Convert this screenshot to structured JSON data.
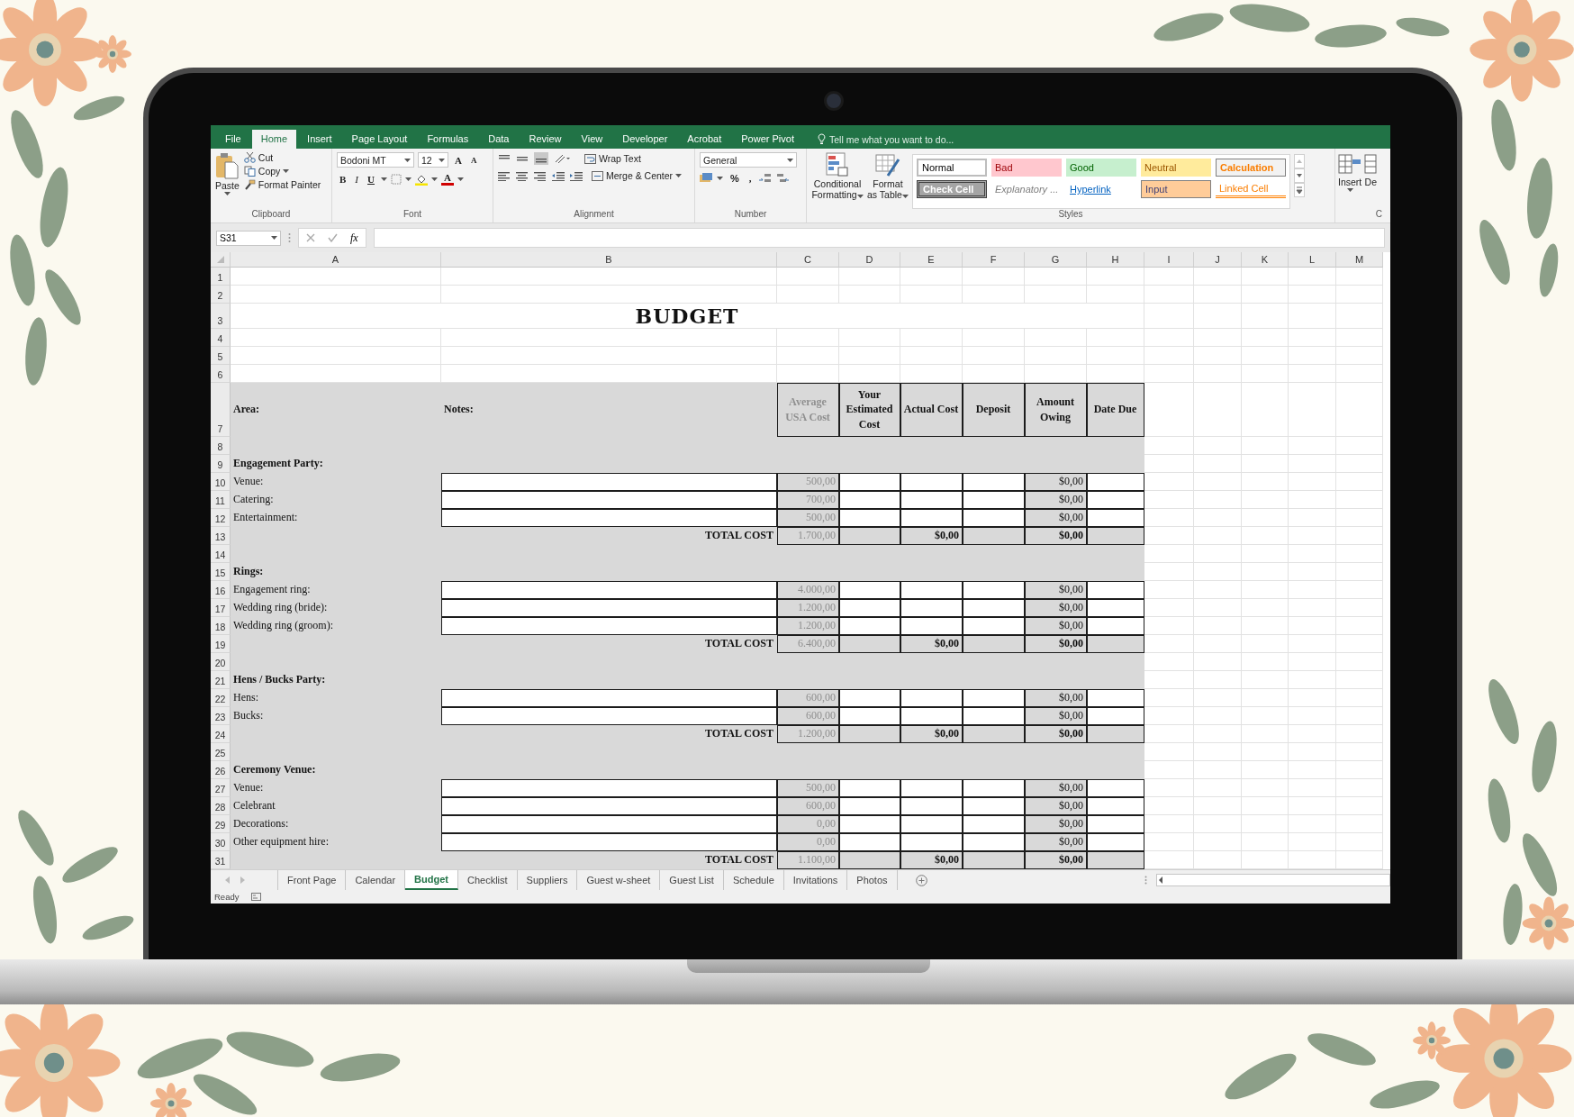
{
  "menu_tabs": [
    {
      "label": "File",
      "selected": false
    },
    {
      "label": "Home",
      "selected": true
    },
    {
      "label": "Insert",
      "selected": false
    },
    {
      "label": "Page Layout",
      "selected": false
    },
    {
      "label": "Formulas",
      "selected": false
    },
    {
      "label": "Data",
      "selected": false
    },
    {
      "label": "Review",
      "selected": false
    },
    {
      "label": "View",
      "selected": false
    },
    {
      "label": "Developer",
      "selected": false
    },
    {
      "label": "Acrobat",
      "selected": false
    },
    {
      "label": "Power Pivot",
      "selected": false
    }
  ],
  "tell_me": "Tell me what you want to do...",
  "ribbon": {
    "clipboard": {
      "label": "Clipboard",
      "paste": "Paste",
      "cut": "Cut",
      "copy": "Copy",
      "format_painter": "Format Painter"
    },
    "font": {
      "label": "Font",
      "family": "Bodoni MT",
      "size": "12",
      "grow": "A",
      "shrink": "A",
      "bold": "B",
      "italic": "I",
      "underline": "U",
      "font_color_glyph": "A"
    },
    "alignment": {
      "label": "Alignment",
      "wrap_text": "Wrap Text",
      "merge": "Merge & Center"
    },
    "number": {
      "label": "Number",
      "format": "General",
      "percent": "%",
      "comma": ","
    },
    "styles": {
      "label": "Styles",
      "conditional": "Conditional Formatting",
      "format_table": "Format as Table",
      "cell_styles": [
        {
          "label": "Normal",
          "kind": "normal"
        },
        {
          "label": "Bad",
          "kind": "bad"
        },
        {
          "label": "Good",
          "kind": "good"
        },
        {
          "label": "Neutral",
          "kind": "neutral"
        },
        {
          "label": "Calculation",
          "kind": "calculation"
        },
        {
          "label": "Check Cell",
          "kind": "check"
        },
        {
          "label": "Explanatory ...",
          "kind": "explanatory"
        },
        {
          "label": "Hyperlink",
          "kind": "hyperlink"
        },
        {
          "label": "Input",
          "kind": "input"
        },
        {
          "label": "Linked Cell",
          "kind": "linked"
        }
      ]
    },
    "cells": {
      "label": "C",
      "insert": "Insert",
      "delete": "De"
    }
  },
  "formula_bar": {
    "name_box": "S31",
    "function_label": "fx"
  },
  "sheet": {
    "columns": [
      "A",
      "B",
      "C",
      "D",
      "E",
      "F",
      "G",
      "H",
      "I",
      "J",
      "K",
      "L",
      "M"
    ],
    "rows": [
      {
        "number": "1",
        "kind": "blank"
      },
      {
        "number": "2",
        "kind": "blank"
      },
      {
        "number": "3",
        "kind": "title",
        "text": "BUDGET"
      },
      {
        "number": "4",
        "kind": "blank"
      },
      {
        "number": "5",
        "kind": "blank"
      },
      {
        "number": "6",
        "kind": "blank"
      },
      {
        "number": "7",
        "kind": "header",
        "area": "Area:",
        "notes": "Notes:",
        "columns": [
          {
            "text": "Average USA Cost",
            "muted": true
          },
          {
            "text": "Your Estimated Cost",
            "muted": false
          },
          {
            "text": "Actual Cost",
            "muted": false
          },
          {
            "text": "Deposit",
            "muted": false
          },
          {
            "text": "Amount Owing",
            "muted": false
          },
          {
            "text": "Date Due",
            "muted": false
          }
        ]
      },
      {
        "number": "8",
        "kind": "gap"
      },
      {
        "number": "9",
        "kind": "section",
        "label": "Engagement Party:"
      },
      {
        "number": "10",
        "kind": "item",
        "label": "Venue:",
        "average": "500,00",
        "owing": "$0,00"
      },
      {
        "number": "11",
        "kind": "item",
        "label": "Catering:",
        "average": "700,00",
        "owing": "$0,00"
      },
      {
        "number": "12",
        "kind": "item",
        "label": "Entertainment:",
        "average": "500,00",
        "owing": "$0,00"
      },
      {
        "number": "13",
        "kind": "total",
        "label": "TOTAL COST",
        "average": "1.700,00",
        "actual": "$0,00",
        "owing": "$0,00"
      },
      {
        "number": "14",
        "kind": "gap"
      },
      {
        "number": "15",
        "kind": "section",
        "label": "Rings:"
      },
      {
        "number": "16",
        "kind": "item",
        "label": "Engagement ring:",
        "average": "4.000,00",
        "owing": "$0,00"
      },
      {
        "number": "17",
        "kind": "item",
        "label": "Wedding ring (bride):",
        "average": "1.200,00",
        "owing": "$0,00"
      },
      {
        "number": "18",
        "kind": "item",
        "label": "Wedding ring (groom):",
        "average": "1.200,00",
        "owing": "$0,00"
      },
      {
        "number": "19",
        "kind": "total",
        "label": "TOTAL COST",
        "average": "6.400,00",
        "actual": "$0,00",
        "owing": "$0,00"
      },
      {
        "number": "20",
        "kind": "gap"
      },
      {
        "number": "21",
        "kind": "section",
        "label": "Hens / Bucks Party:"
      },
      {
        "number": "22",
        "kind": "item",
        "label": "Hens:",
        "average": "600,00",
        "owing": "$0,00"
      },
      {
        "number": "23",
        "kind": "item",
        "label": "Bucks:",
        "average": "600,00",
        "owing": "$0,00"
      },
      {
        "number": "24",
        "kind": "total",
        "label": "TOTAL COST",
        "average": "1.200,00",
        "actual": "$0,00",
        "owing": "$0,00"
      },
      {
        "number": "25",
        "kind": "gap"
      },
      {
        "number": "26",
        "kind": "section",
        "label": "Ceremony Venue:"
      },
      {
        "number": "27",
        "kind": "item",
        "label": "Venue:",
        "average": "500,00",
        "owing": "$0,00"
      },
      {
        "number": "28",
        "kind": "item",
        "label": "Celebrant",
        "average": "600,00",
        "owing": "$0,00"
      },
      {
        "number": "29",
        "kind": "item",
        "label": "Decorations:",
        "average": "0,00",
        "owing": "$0,00"
      },
      {
        "number": "30",
        "kind": "item",
        "label": "Other equipment hire:",
        "average": "0,00",
        "owing": "$0,00"
      },
      {
        "number": "31",
        "kind": "total",
        "label": "TOTAL COST",
        "average": "1.100,00",
        "actual": "$0,00",
        "owing": "$0,00"
      }
    ]
  },
  "sheet_tabs": [
    {
      "label": "Front Page",
      "selected": false
    },
    {
      "label": "Calendar",
      "selected": false
    },
    {
      "label": "Budget",
      "selected": true
    },
    {
      "label": "Checklist",
      "selected": false
    },
    {
      "label": "Suppliers",
      "selected": false
    },
    {
      "label": "Guest w-sheet",
      "selected": false
    },
    {
      "label": "Guest List",
      "selected": false
    },
    {
      "label": "Schedule",
      "selected": false
    },
    {
      "label": "Invitations",
      "selected": false
    },
    {
      "label": "Photos",
      "selected": false
    }
  ],
  "status": "Ready"
}
